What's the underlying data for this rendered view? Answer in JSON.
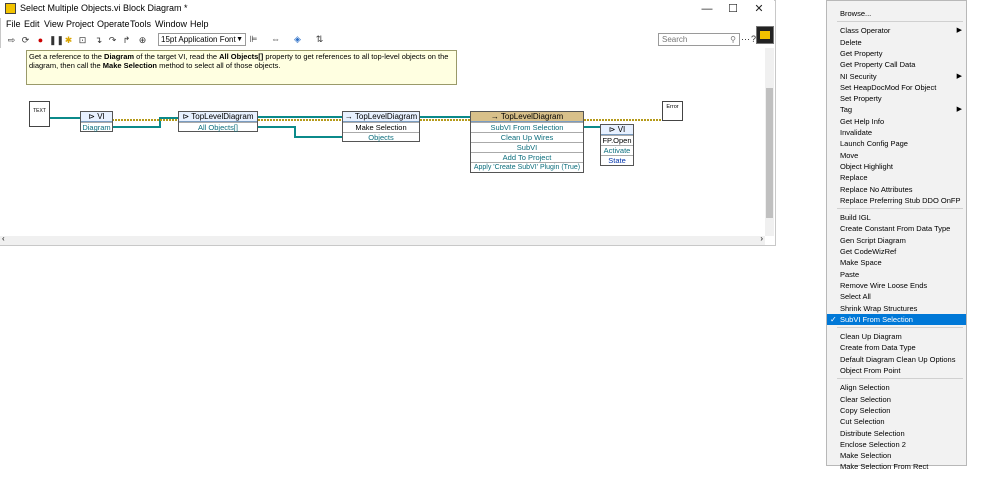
{
  "window": {
    "title": "Select Multiple Objects.vi Block Diagram *",
    "minimize": "—",
    "maximize": "☐",
    "close": "✕"
  },
  "menubar": [
    "File",
    "Edit",
    "View",
    "Project",
    "Operate",
    "Tools",
    "Window",
    "Help"
  ],
  "toolbar": {
    "font_select": "15pt Application Font",
    "search_placeholder": "Search"
  },
  "comment": {
    "part1": "Get a reference to the ",
    "bold1": "Diagram",
    "part2": " of the target VI, read the ",
    "bold2": "All Objects[]",
    "part3": " property to get references to all top-level objects on the diagram, then call the ",
    "bold3": "Make Selection",
    "part4": " method to select all of those objects."
  },
  "diagram": {
    "text_const": "TEXT",
    "node1": {
      "head": "VI",
      "row1": "Diagram"
    },
    "node2": {
      "head": "TopLevelDiagram",
      "row1": "All Objects[]"
    },
    "node3": {
      "head": "TopLevelDiagram",
      "row1": "Make Selection",
      "row2": "Objects"
    },
    "node4": {
      "head": "TopLevelDiagram",
      "rows": [
        "SubVI From Selection",
        "Clean Up Wires",
        "SubVI",
        "Add To Project",
        "Apply 'Create SubVI' Plugin (True)"
      ]
    },
    "node5": {
      "head": "VI",
      "rows": [
        "FP.Open",
        "Activate",
        "State"
      ]
    },
    "error_out": "Error"
  },
  "context_menu": {
    "groups": [
      [
        {
          "label": "Browse...",
          "sub": false
        }
      ],
      [
        {
          "label": "Class Operator",
          "sub": true
        },
        {
          "label": "Delete",
          "sub": false
        },
        {
          "label": "Get Property",
          "sub": false
        },
        {
          "label": "Get Property Call Data",
          "sub": false
        },
        {
          "label": "NI Security",
          "sub": true
        },
        {
          "label": "Set HeapDocMod For Object",
          "sub": false
        },
        {
          "label": "Set Property",
          "sub": false
        },
        {
          "label": "Tag",
          "sub": true
        },
        {
          "label": "Get Help Info",
          "sub": false
        },
        {
          "label": "Invalidate",
          "sub": false
        },
        {
          "label": "Launch Config Page",
          "sub": false
        },
        {
          "label": "Move",
          "sub": false
        },
        {
          "label": "Object Highlight",
          "sub": false
        },
        {
          "label": "Replace",
          "sub": false
        },
        {
          "label": "Replace No Attributes",
          "sub": false
        },
        {
          "label": "Replace Preferring Stub DDO OnFP",
          "sub": false
        }
      ],
      [
        {
          "label": "Build IGL",
          "sub": false
        },
        {
          "label": "Create Constant From Data Type",
          "sub": false
        },
        {
          "label": "Gen Script Diagram",
          "sub": false
        },
        {
          "label": "Get CodeWizRef",
          "sub": false
        },
        {
          "label": "Make Space",
          "sub": false
        },
        {
          "label": "Paste",
          "sub": false
        },
        {
          "label": "Remove Wire Loose Ends",
          "sub": false
        },
        {
          "label": "Select All",
          "sub": false
        },
        {
          "label": "Shrink Wrap Structures",
          "sub": false
        },
        {
          "label": "SubVI From Selection",
          "sub": false,
          "checked": true,
          "selected": true
        }
      ],
      [
        {
          "label": "Clean Up Diagram",
          "sub": false
        },
        {
          "label": "Create from Data Type",
          "sub": false
        },
        {
          "label": "Default Diagram Clean Up Options",
          "sub": false
        },
        {
          "label": "Object From Point",
          "sub": false
        }
      ],
      [
        {
          "label": "Align Selection",
          "sub": false
        },
        {
          "label": "Clear Selection",
          "sub": false
        },
        {
          "label": "Copy Selection",
          "sub": false
        },
        {
          "label": "Cut Selection",
          "sub": false
        },
        {
          "label": "Distribute Selection",
          "sub": false
        },
        {
          "label": "Enclose Selection 2",
          "sub": false
        },
        {
          "label": "Make Selection",
          "sub": false
        },
        {
          "label": "Make Selection From Rect",
          "sub": false
        }
      ]
    ]
  },
  "colors": {
    "selected": "#0078d7",
    "comment_bg": "#ffffe1",
    "ref_wire": "#0b8a8a",
    "error_wire": "#b59a1a"
  }
}
